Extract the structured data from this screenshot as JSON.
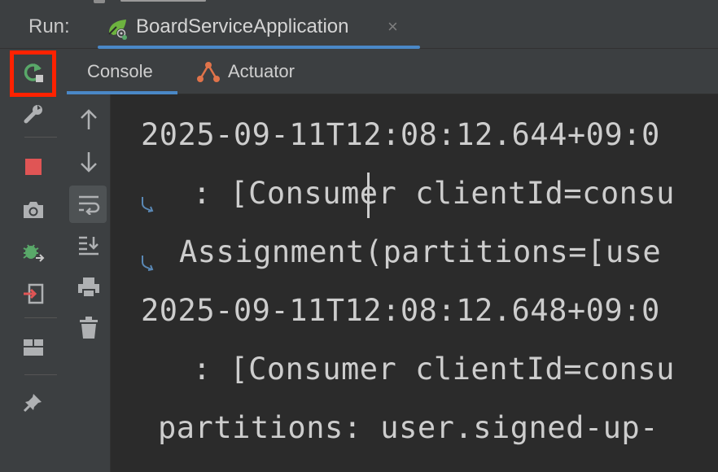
{
  "run_bar": {
    "label": "Run:",
    "tab_title": "BoardServiceApplication",
    "close_glyph": "×"
  },
  "sub_tabs": {
    "console": "Console",
    "actuator": "Actuator"
  },
  "left_toolbar": {
    "items": [
      "rerun-icon",
      "wrench-icon",
      "stop-icon",
      "camera-icon",
      "debug-icon",
      "exit-icon",
      "layout-icon",
      "pin-icon"
    ]
  },
  "second_toolbar": {
    "items": [
      "arrow-up-icon",
      "arrow-down-icon",
      "soft-wrap-icon",
      "scroll-to-end-icon",
      "print-icon",
      "trash-icon"
    ]
  },
  "console": {
    "lines": [
      "2025-09-11T12:08:12.644+09:0",
      " : [Consumer clientId=consu",
      "Assignment(partitions=[use",
      "2025-09-11T12:08:12.648+09:0",
      " : [Consumer clientId=consu",
      "partitions: user.signed-up-"
    ]
  },
  "colors": {
    "accent_blue": "#4a88c7",
    "highlight_red": "#ff2200",
    "stop_red": "#e05555",
    "spring_green": "#6db33f",
    "actuator_orange": "#e0734a"
  }
}
